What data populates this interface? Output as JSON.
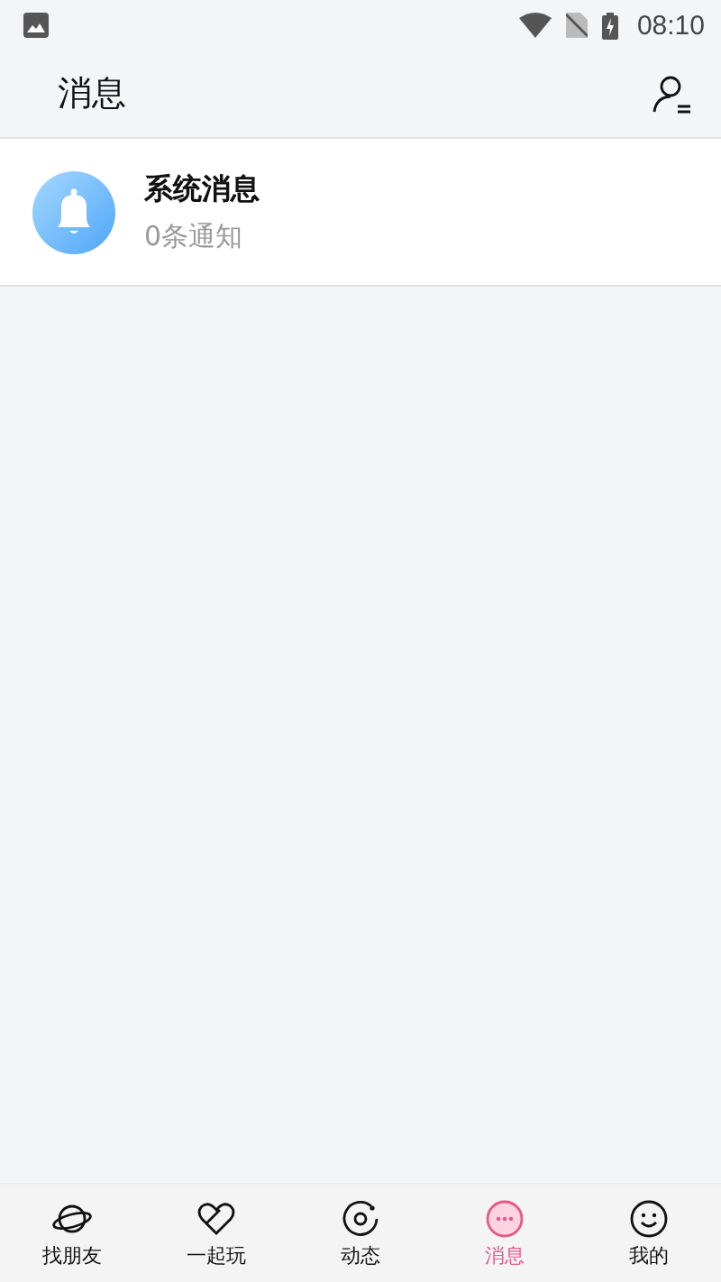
{
  "status_bar": {
    "time": "08:10"
  },
  "header": {
    "title": "消息"
  },
  "messages": [
    {
      "title": "系统消息",
      "subtitle": "0条通知"
    }
  ],
  "tabs": [
    {
      "kind": "planet",
      "label": "找朋友",
      "selected": false
    },
    {
      "kind": "heart",
      "label": "一起玩",
      "selected": false
    },
    {
      "kind": "disc",
      "label": "动态",
      "selected": false
    },
    {
      "kind": "chat",
      "label": "消息",
      "selected": true
    },
    {
      "kind": "smile",
      "label": "我的",
      "selected": false
    }
  ]
}
